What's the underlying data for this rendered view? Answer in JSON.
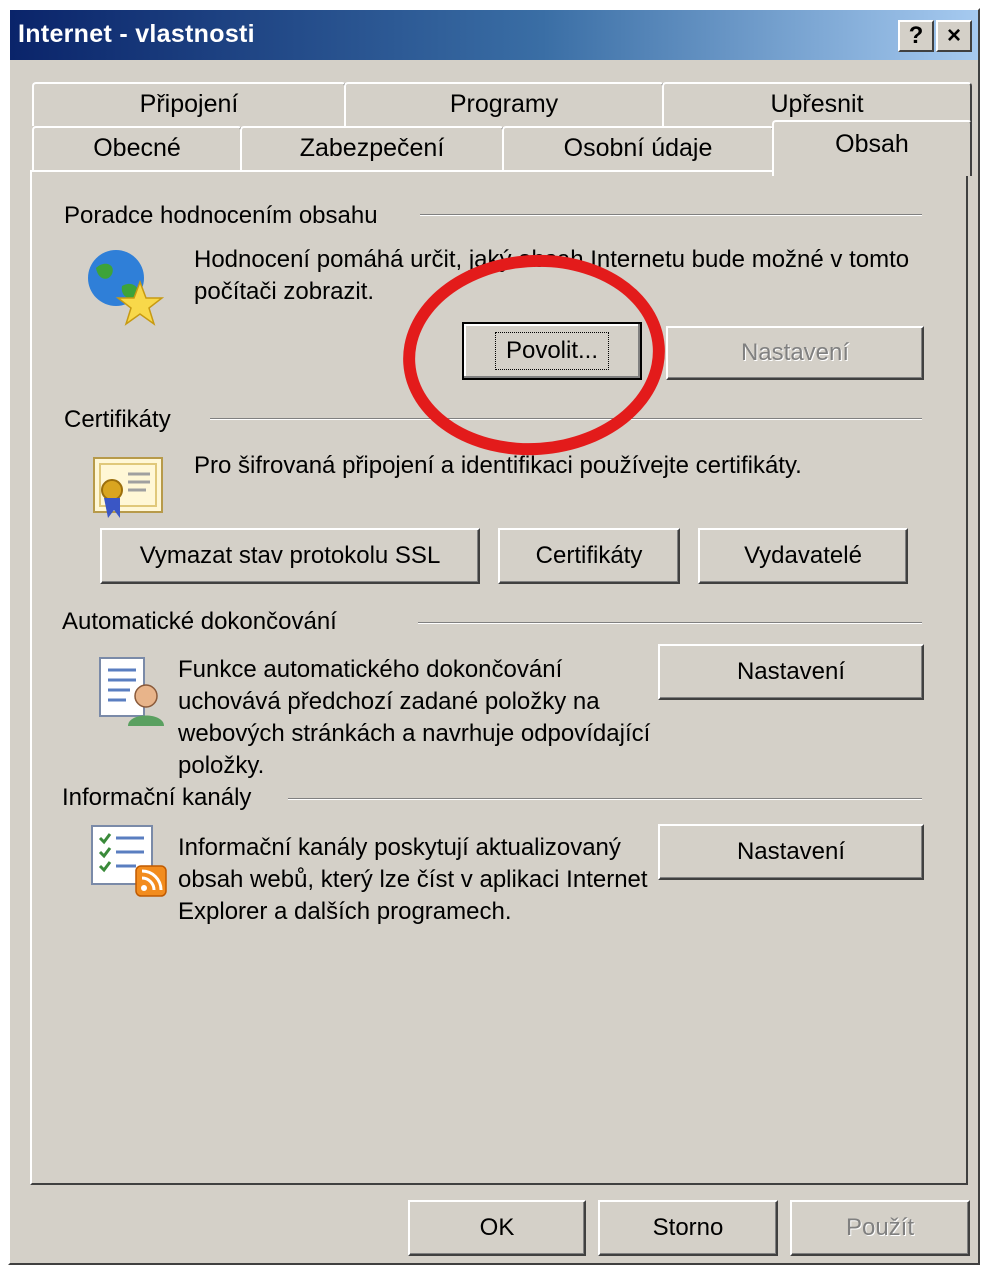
{
  "window": {
    "title": "Internet - vlastnosti",
    "help_label": "?",
    "close_label": "×"
  },
  "tabs_row1": [
    {
      "label": "Připojení"
    },
    {
      "label": "Programy"
    },
    {
      "label": "Upřesnit"
    }
  ],
  "tabs_row2": [
    {
      "label": "Obecné"
    },
    {
      "label": "Zabezpečení"
    },
    {
      "label": "Osobní údaje"
    },
    {
      "label": "Obsah",
      "active": true
    }
  ],
  "content_advisor": {
    "heading": "Poradce hodnocením obsahu",
    "description": "Hodnocení pomáhá určit, jaký obsah Internetu bude možné v tomto počítači zobrazit.",
    "enable_button": "Povolit...",
    "settings_button": "Nastavení",
    "icon": "globe-star-icon"
  },
  "certificates": {
    "heading": "Certifikáty",
    "description": "Pro šifrovaná připojení a identifikaci používejte certifikáty.",
    "clear_ssl_button": "Vymazat stav protokolu SSL",
    "certificates_button": "Certifikáty",
    "publishers_button": "Vydavatelé",
    "icon": "certificate-icon"
  },
  "autocomplete": {
    "heading": "Automatické dokončování",
    "description": "Funkce automatického dokončování uchovává předchozí zadané položky na webových stránkách a navrhuje odpovídající položky.",
    "settings_button": "Nastavení",
    "icon": "autocomplete-form-icon"
  },
  "feeds": {
    "heading": "Informační kanály",
    "description": "Informační kanály poskytují aktualizovaný obsah webů, který lze číst v aplikaci Internet Explorer a dalších programech.",
    "settings_button": "Nastavení",
    "icon": "rss-feed-icon"
  },
  "footer": {
    "ok": "OK",
    "cancel": "Storno",
    "apply": "Použít"
  },
  "colors": {
    "annotation": "#e31b1b",
    "titlebar": "#0a246a",
    "face": "#d4d0c8"
  }
}
